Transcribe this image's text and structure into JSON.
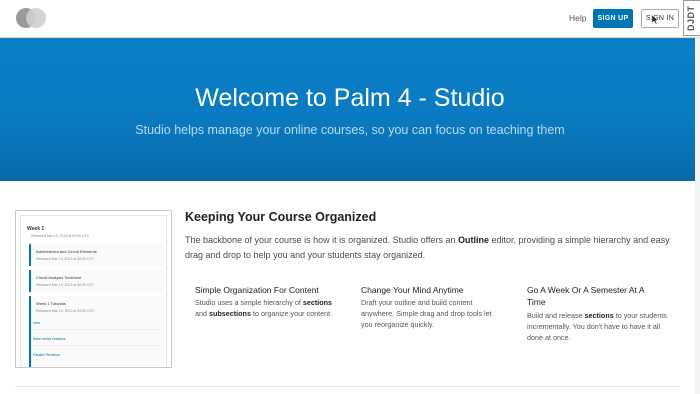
{
  "header": {
    "help_label": "Help",
    "signup_label": "SIGN UP",
    "signin_label": "SIGN IN",
    "debug_toolbar_label": "DJDT"
  },
  "hero": {
    "title": "Welcome to Palm 4 - Studio",
    "subtitle": "Studio helps manage your online courses, so you can focus on teaching them"
  },
  "thumbnail": {
    "week1": "Week 1",
    "week1_released": "Released Mar 13, 2013 at 00:00 UTC",
    "sub1_title": "Administrivia and Circuit Elements",
    "sub1_released": "Released Mar 13, 2013 at 00:00 UTC",
    "sub2_title": "Circuit Analysis Toolchest",
    "sub2_released": "Released Mar 13, 2013 at 00:00 UTC",
    "sub3_title": "Week 1 Tutorials",
    "sub3_released": "Released Mar 13, 2013 at 00:00 UTC",
    "unit1": "intro",
    "unit2": "three series resistors",
    "unit3": "Parallel Resistors"
  },
  "section": {
    "title": "Keeping Your Course Organized",
    "body_pre": "The backbone of your course is how it is organized. Studio offers an ",
    "body_bold": "Outline",
    "body_post": " editor, providing a simple hierarchy and easy drag and drop to help you and your students stay organized."
  },
  "columns": [
    {
      "title": "Simple Organization For Content",
      "body_a": "Studio uses a simple hierarchy of ",
      "body_b": "sections",
      "body_c": " and ",
      "body_d": "subsections",
      "body_e": " to organize your content."
    },
    {
      "title": "Change Your Mind Anytime",
      "body": "Draft your outline and build content anywhere. Simple drag and drop tools let you reorganize quickly."
    },
    {
      "title": "Go A Week Or A Semester At A Time",
      "body_a": "Build and release ",
      "body_b": "sections",
      "body_c": " to your students incrementally. You don't have to have it all done at once."
    }
  ],
  "colors": {
    "brand_blue": "#0075b4",
    "hero_blue": "#0a7fc7"
  }
}
